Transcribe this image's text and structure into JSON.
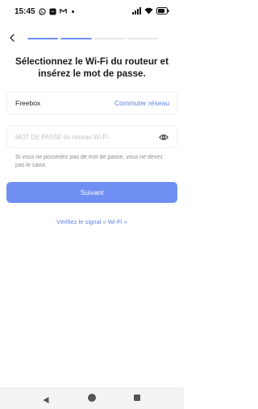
{
  "status_bar": {
    "time": "15:45",
    "app_icons": [
      "whatsapp-icon",
      "messenger-icon",
      "gmail-icon",
      "notification-dot-icon"
    ],
    "right_icons": [
      "signal-icon",
      "wifi-icon",
      "battery-icon"
    ]
  },
  "header": {
    "back_icon": "chevron-left-icon",
    "progress_total_steps": 4,
    "progress_completed_steps": 2
  },
  "page": {
    "title": "Sélectionnez le Wi-Fi du routeur et insérez le mot de passe."
  },
  "network": {
    "name": "Freebox",
    "switch_label": "Commuter réseau"
  },
  "password": {
    "value": "",
    "placeholder": "MOT DE PASSE du réseau Wi-Fi",
    "visibility_icon": "eye-icon"
  },
  "hint": "Si vous ne possédez pas de mot de passe, vous ne devez pas le saisir.",
  "submit_label": "Suivant",
  "check_signal_label": "Vérifiez le signal « Wi-Fi »",
  "colors": {
    "accent": "#6f8ff3",
    "link": "#5b7fe8",
    "progress_inactive": "#e5e5e5",
    "hint_text": "#8a8a8a",
    "placeholder": "#c4c4c4"
  },
  "nav_bar": {
    "icons": [
      "nav-back-icon",
      "nav-home-icon",
      "nav-recents-icon"
    ]
  }
}
